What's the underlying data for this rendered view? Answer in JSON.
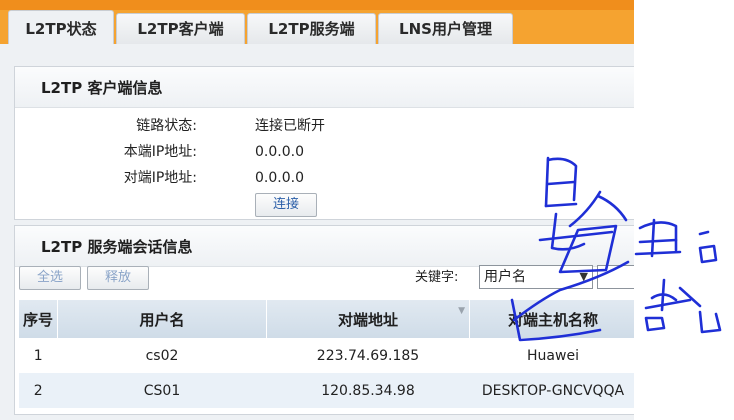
{
  "tabs": [
    {
      "label": "L2TP状态",
      "active": true
    },
    {
      "label": "L2TP客户端",
      "active": false
    },
    {
      "label": "L2TP服务端",
      "active": false
    },
    {
      "label": "LNS用户管理",
      "active": false
    }
  ],
  "client_info": {
    "title": "L2TP 客户端信息",
    "link_status_label": "链路状态:",
    "link_status_value": "连接已断开",
    "local_ip_label": "本端IP地址:",
    "local_ip_value": "0.0.0.0",
    "peer_ip_label": "对端IP地址:",
    "peer_ip_value": "0.0.0.0",
    "connect_button": "连接"
  },
  "server_sessions": {
    "title": "L2TP 服务端会话信息",
    "select_all_button": "全选",
    "release_button": "释放",
    "keyword_label": "关键字:",
    "keyword_select_value": "用户名",
    "keyword_input_value": "",
    "columns": [
      "序号",
      "用户名",
      "对端地址",
      "对端主机名称"
    ],
    "rows": [
      {
        "index": "1",
        "username": "cs02",
        "peer_address": "223.74.69.185",
        "peer_hostname": "Huawei"
      },
      {
        "index": "2",
        "username": "CS01",
        "peer_address": "120.85.34.98",
        "peer_hostname": "DESKTOP-GNCVQQA"
      }
    ]
  },
  "colors": {
    "topbar": "#f5a330",
    "panel_bg": "#eef1f4",
    "table_header": "#cfdce8",
    "row_alt": "#eaf1f8",
    "ink": "#1f2fd6"
  },
  "icons": {
    "sort": "sort-arrow-icon",
    "dropdown": "chevron-down-icon"
  }
}
